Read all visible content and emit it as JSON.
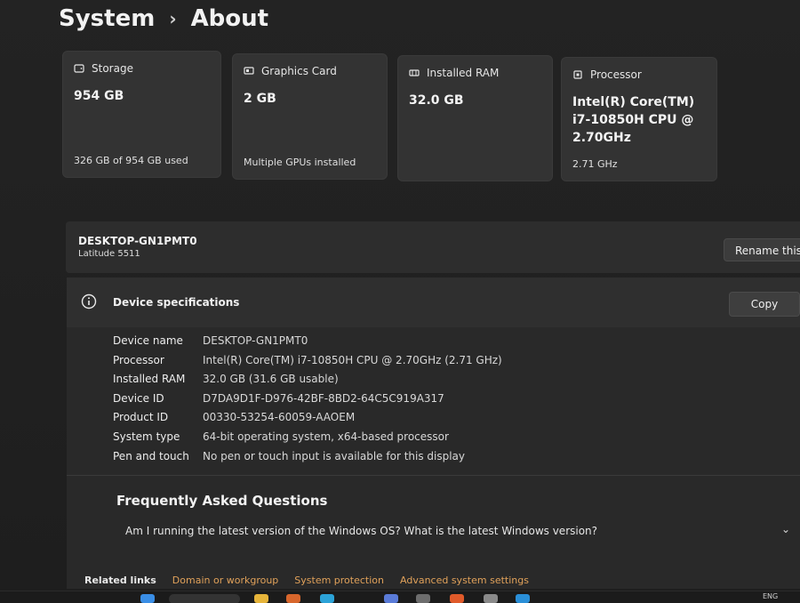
{
  "breadcrumb": {
    "parent": "System",
    "current": "About"
  },
  "cards": {
    "storage": {
      "title": "Storage",
      "value": "954 GB",
      "sub": "326 GB of 954 GB used"
    },
    "gpu": {
      "title": "Graphics Card",
      "value": "2 GB",
      "sub": "Multiple GPUs installed"
    },
    "ram": {
      "title": "Installed RAM",
      "value": "32.0 GB",
      "sub": ""
    },
    "cpu": {
      "title": "Processor",
      "value_line1": "Intel(R) Core(TM)",
      "value_line2": "i7-10850H CPU @",
      "value_line3": "2.70GHz",
      "sub": "2.71 GHz"
    }
  },
  "device": {
    "name": "DESKTOP-GN1PMT0",
    "model": "Latitude 5511",
    "rename_label": "Rename this PC"
  },
  "specs": {
    "title": "Device specifications",
    "copy_label": "Copy",
    "rows": [
      {
        "key": "Device name",
        "value": "DESKTOP-GN1PMT0"
      },
      {
        "key": "Processor",
        "value": "Intel(R) Core(TM) i7-10850H CPU @ 2.70GHz (2.71 GHz)"
      },
      {
        "key": "Installed RAM",
        "value": "32.0 GB (31.6 GB usable)"
      },
      {
        "key": "Device ID",
        "value": "D7DA9D1F-D976-42BF-8BD2-64C5C919A317"
      },
      {
        "key": "Product ID",
        "value": "00330-53254-60059-AAOEM"
      },
      {
        "key": "System type",
        "value": "64-bit operating system, x64-based processor"
      },
      {
        "key": "Pen and touch",
        "value": "No pen or touch input is available for this display"
      }
    ]
  },
  "faq": {
    "title": "Frequently Asked Questions",
    "question": "Am I running the latest version of the Windows OS? What is the latest Windows version?"
  },
  "related": {
    "lead": "Related links",
    "links": [
      "Domain or workgroup",
      "System protection",
      "Advanced system settings"
    ]
  },
  "taskbar": {
    "lang": "ENG"
  },
  "colors": {
    "accent_link": "#e0a15a",
    "card_bg": "#333333",
    "page_bg": "#1f1f1f"
  }
}
